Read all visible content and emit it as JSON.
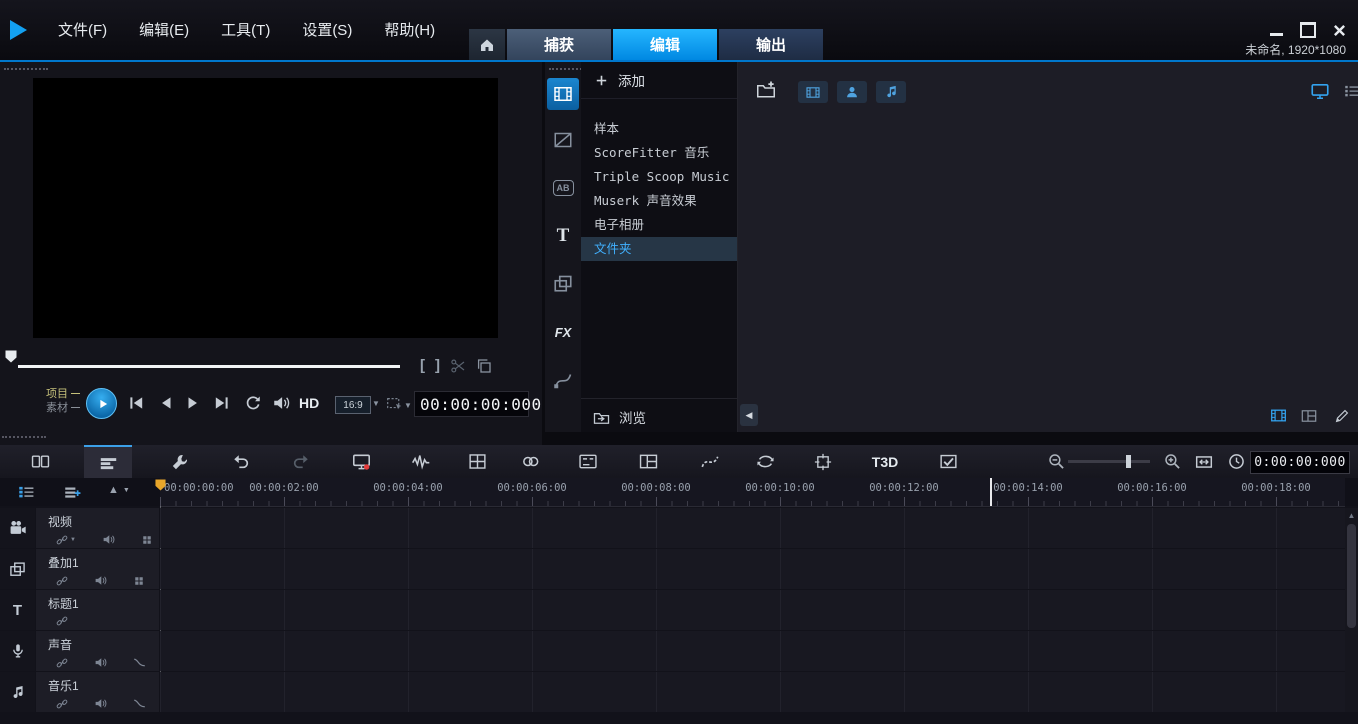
{
  "app": {
    "accent": "#00a2ff",
    "title": "未命名, 1920*1080"
  },
  "menubar": {
    "items": [
      {
        "label": "文件(F)"
      },
      {
        "label": "编辑(E)"
      },
      {
        "label": "工具(T)"
      },
      {
        "label": "设置(S)"
      },
      {
        "label": "帮助(H)"
      }
    ]
  },
  "workspace_tabs": {
    "items": [
      {
        "label": "捕获",
        "active": false
      },
      {
        "label": "编辑",
        "active": true
      },
      {
        "label": "输出",
        "active": false
      }
    ]
  },
  "preview": {
    "project_label": "项目",
    "clip_label": "素材",
    "hd_label": "HD",
    "aspect_value": "16:9",
    "timecode": "00:00:00:000"
  },
  "library": {
    "add_label": "添加",
    "icon_ab": "AB",
    "icon_t": "T",
    "icon_fx": "FX",
    "nav_items": [
      {
        "label": "样本",
        "selected": false
      },
      {
        "label": "ScoreFitter 音乐",
        "selected": false
      },
      {
        "label": "Triple Scoop Music",
        "selected": false
      },
      {
        "label": "Muserk 声音效果",
        "selected": false
      },
      {
        "label": "电子相册",
        "selected": false
      },
      {
        "label": "文件夹",
        "selected": true
      }
    ],
    "browse_label": "浏览"
  },
  "toolbar": {
    "t3d_label": "T3D",
    "timecode": "0:00:00:000"
  },
  "timeline": {
    "ruler": [
      "00:00:00:00",
      "00:00:02:00",
      "00:00:04:00",
      "00:00:06:00",
      "00:00:08:00",
      "00:00:10:00",
      "00:00:12:00",
      "00:00:14:00",
      "00:00:16:00",
      "00:00:18:00"
    ],
    "tracks": [
      {
        "label": "视频",
        "type": "video"
      },
      {
        "label": "叠加1",
        "type": "overlay"
      },
      {
        "label": "标题1",
        "type": "title"
      },
      {
        "label": "声音",
        "type": "voice"
      },
      {
        "label": "音乐1",
        "type": "music"
      }
    ]
  }
}
